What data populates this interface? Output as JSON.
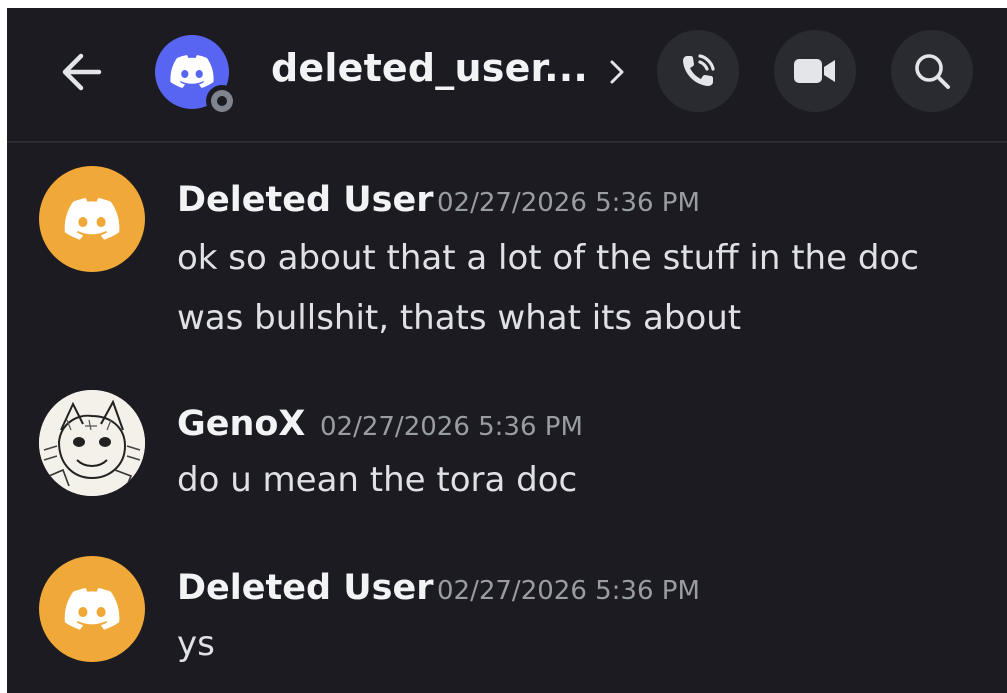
{
  "header": {
    "channel_name": "deleted_user...",
    "icons": {
      "back": "arrow-left-icon",
      "chevron": "chevron-right-icon",
      "call": "phone-call-icon",
      "video": "video-camera-icon",
      "search": "search-icon"
    }
  },
  "messages": [
    {
      "author": "Deleted User",
      "timestamp": "02/27/2026 5:36 PM",
      "text_lines": [
        "ok so about that a lot of the stuff in the doc",
        "was bullshit, thats what its about"
      ],
      "avatar": "discord-logo-orange"
    },
    {
      "author": "GenoX",
      "timestamp": "02/27/2026 5:36 PM",
      "text_lines": [
        "do u mean the tora doc"
      ],
      "avatar": "sketch-character"
    },
    {
      "author": "Deleted User",
      "timestamp": "02/27/2026 5:36 PM",
      "text_lines": [
        "ys"
      ],
      "avatar": "discord-logo-orange"
    }
  ],
  "colors": {
    "background": "#1b1b21",
    "blurple": "#5865f2",
    "orange_avatar": "#f0a838",
    "button_bg": "#2a2b31",
    "timestamp": "#9a9ca3"
  }
}
